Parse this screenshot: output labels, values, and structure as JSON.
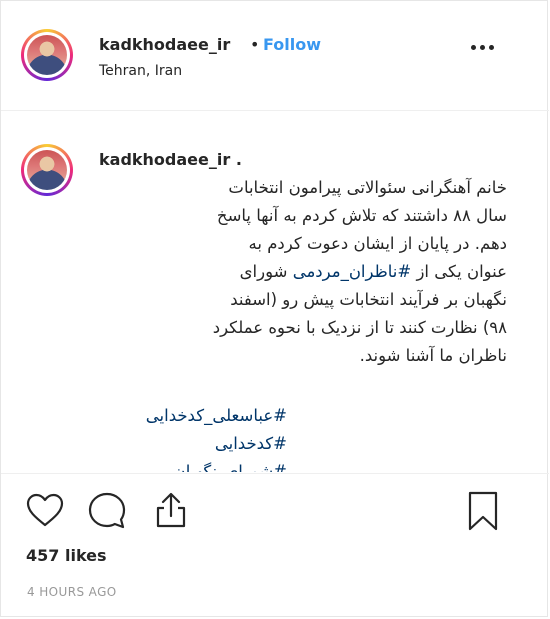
{
  "post": {
    "username": "kadkhodaee_ir",
    "follow_label": "Follow",
    "separator": "•",
    "location": "Tehran, Iran"
  },
  "caption": {
    "username": "kadkhodaee_ir .",
    "line1": "خانم آهنگرانی سئوالاتی پیرامون انتخابات",
    "line2": "سال ۸۸ داشتند که تلاش کردم به آنها پاسخ",
    "line3": "دهم. در پایان از ایشان دعوت کردم به",
    "line4_prefix": "عنوان یکی از ",
    "line4_hashtag": "#ناظران_مردمی",
    "line4_suffix": " شورای",
    "line5": "نگهبان بر فرآیند انتخابات پیش رو (اسفند",
    "line6": "۹۸) نظارت کنند تا از نزدیک با نحوه عملکرد",
    "line7": "ناظران ما آشنا شوند."
  },
  "hashtags": [
    "#عباسعلی_کدخدایی",
    "#کدخدایی",
    "#شورای_نگهبان"
  ],
  "engagement": {
    "likes": "457 likes",
    "time": "4 HOURS AGO"
  },
  "icons": [
    "more-options-icon",
    "heart-icon",
    "comment-icon",
    "share-icon",
    "bookmark-icon"
  ]
}
